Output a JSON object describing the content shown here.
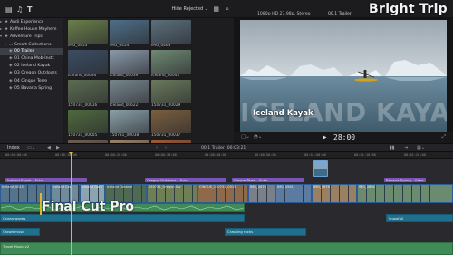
{
  "libraries": {
    "items": [
      {
        "label": "Audi Experience",
        "indent": 0
      },
      {
        "label": "Koffee House Mayhem",
        "indent": 0
      },
      {
        "label": "Adventure Trips",
        "indent": 0
      },
      {
        "label": "Smart Collections",
        "indent": 1
      },
      {
        "label": "00 Trailer",
        "indent": 1,
        "selected": true
      },
      {
        "label": "01 China Mob-Instr.",
        "indent": 1
      },
      {
        "label": "02 Iceland Kayak",
        "indent": 1
      },
      {
        "label": "03 Oregon Outdoors",
        "indent": 1
      },
      {
        "label": "04 Cinque Terre",
        "indent": 1
      },
      {
        "label": "05 Bavaria Spring",
        "indent": 1
      }
    ]
  },
  "browser": {
    "filter_label": "Hide Rejected",
    "clips": [
      {
        "caption": "IMG_0453",
        "color": "#6a7f4a"
      },
      {
        "caption": "IMG_0454",
        "color": "#4d6f88"
      },
      {
        "caption": "IMG_0463",
        "color": "#5a6f7c"
      },
      {
        "caption": "Iceland_00034",
        "color": "#3b4e63"
      },
      {
        "caption": "Iceland_00039",
        "color": "#8a9aaa"
      },
      {
        "caption": "Iceland_00041",
        "color": "#6f8a72"
      },
      {
        "caption": "150731_00016",
        "color": "#5b6d52"
      },
      {
        "caption": "Iceland_00622",
        "color": "#77878e"
      },
      {
        "caption": "150731_00029",
        "color": "#6a7a5c"
      },
      {
        "caption": "150731_00005",
        "color": "#4f6a3e"
      },
      {
        "caption": "150731_00038",
        "color": "#8aa0a8"
      },
      {
        "caption": "150731_00037",
        "color": "#7a5f3e"
      },
      {
        "caption": "5HBBHs",
        "color": "#6f5f52"
      },
      {
        "caption": "IMG_0456",
        "color": "#9b8468"
      },
      {
        "caption": "IMG_0458",
        "color": "#a05a30"
      }
    ]
  },
  "viewer": {
    "format": "1080p HD 23.98p, Stereo",
    "title": "00.1 Trailer",
    "overlay_big": "ICELAND KAYAK",
    "overlay_small": "Iceland Kayak",
    "timecode": "28:00"
  },
  "brand_watermark": "Bright Trip",
  "timeline": {
    "index_label": "Index",
    "project": "00.1 Trailer",
    "duration": "00:03:21",
    "ruler": [
      "00:00:00:00",
      "00:00:10:00",
      "00:00:20:00",
      "00:00:30:00",
      "00:00:40:00",
      "00:00:50:00",
      "00:01:00:00",
      "00:01:10:00",
      "00:01:20:00"
    ],
    "title_bars": [
      {
        "label": "Iceland Kayak – Echo"
      },
      {
        "label": "Oregon Outdoors – Echo"
      },
      {
        "label": "Cinque Terre – Echo"
      },
      {
        "label": "Bavaria Spring – Echo"
      }
    ],
    "video_clips": [
      {
        "label": "Iceland_0015"
      },
      {
        "label": "Iceland Cap"
      },
      {
        "label": "Iceland Gara"
      },
      {
        "label": "Iceland Outside"
      },
      {
        "label": "150731_Oregon Sur"
      },
      {
        "label": "CINQUE_150731_0015"
      },
      {
        "label": "IMG_0478"
      },
      {
        "label": "IMG_0561"
      },
      {
        "label": "IMG_0678"
      },
      {
        "label": "IMG_0890"
      }
    ],
    "audio_clips": [
      {
        "label": "Ocean waves"
      },
      {
        "label": "Crowd music"
      },
      {
        "label": "Crashing rocks"
      },
      {
        "label": "Snowfall"
      },
      {
        "label": "Travel Music v2"
      }
    ],
    "logo": "Final Cut Pro"
  }
}
